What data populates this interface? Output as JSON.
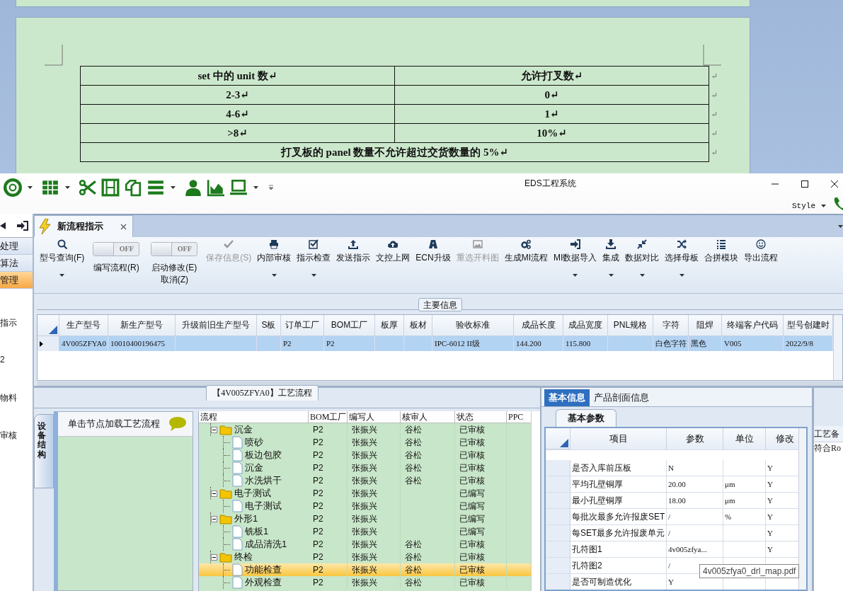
{
  "document": {
    "table": {
      "rows": [
        {
          "cells": [
            "set 中的 unit 数↵",
            "允许打叉数↵"
          ],
          "end_mark": "↵"
        },
        {
          "cells": [
            "2-3↵",
            "0↵"
          ],
          "end_mark": "↵"
        },
        {
          "cells": [
            "4-6↵",
            "1↵"
          ],
          "end_mark": "↵"
        },
        {
          "cells": [
            ">8↵",
            "10%↵"
          ],
          "end_mark": "↵"
        },
        {
          "cells": [
            {
              "text": "打叉板的 panel 数量不允许超过交货数量的 5%↵",
              "colspan": 2
            }
          ],
          "end_mark": "↵"
        }
      ]
    }
  },
  "window": {
    "title": "EDS工程系统",
    "style_menu": "Style"
  },
  "quick_access": [
    {
      "dropdown": true
    },
    {
      "dropdown": true
    },
    {
      "dropdown": false
    },
    {
      "dropdown": false
    },
    {
      "dropdown": false
    },
    {
      "dropdown": true
    },
    {
      "dropdown": false
    },
    {
      "dropdown": false
    },
    {
      "dropdown": true
    },
    {
      "dropdown": true
    }
  ],
  "sidebar": {
    "items": [
      {
        "label": "处理",
        "selected": false
      },
      {
        "label": "算法",
        "selected": false
      },
      {
        "label": "管理",
        "selected": true
      }
    ],
    "texts": [
      "指示",
      "2",
      "物料",
      "审核"
    ]
  },
  "tabs": [
    {
      "label": "新流程指示",
      "selected": true
    }
  ],
  "ribbon": [
    {
      "kind": "button",
      "label": [
        "型号查询(F)"
      ],
      "dropdown": true,
      "disabled": false
    },
    {
      "kind": "toggle",
      "label": [
        "编写流程(R)"
      ],
      "on": false,
      "state_label": "OFF"
    },
    {
      "kind": "toggle",
      "label": [
        "启动修改(E)",
        "取消(Z)"
      ],
      "on": false,
      "state_label": "OFF"
    },
    {
      "kind": "button",
      "label": [
        "保存信息(S)"
      ],
      "dropdown": false,
      "disabled": true
    },
    {
      "kind": "button",
      "label": [
        "内部审核"
      ],
      "dropdown": true,
      "disabled": false
    },
    {
      "kind": "button",
      "label": [
        "指示检查"
      ],
      "dropdown": true,
      "disabled": false
    },
    {
      "kind": "button",
      "label": [
        "发送指示"
      ],
      "dropdown": false,
      "disabled": false
    },
    {
      "kind": "button",
      "label": [
        "文控上网"
      ],
      "dropdown": false,
      "disabled": false
    },
    {
      "kind": "button",
      "label": [
        "ECN升级"
      ],
      "dropdown": false,
      "disabled": false
    },
    {
      "kind": "button",
      "label": [
        "重选开料图"
      ],
      "dropdown": false,
      "disabled": true
    },
    {
      "kind": "button",
      "label": [
        "生成MI流程"
      ],
      "dropdown": false,
      "disabled": false
    },
    {
      "kind": "button",
      "label": [
        "MI数据导入"
      ],
      "dropdown": true,
      "disabled": false
    },
    {
      "kind": "button",
      "label": [
        "集成"
      ],
      "dropdown": true,
      "disabled": false
    },
    {
      "kind": "button",
      "label": [
        "数据对比"
      ],
      "dropdown": true,
      "disabled": false
    },
    {
      "kind": "button",
      "label": [
        "选择母板"
      ],
      "dropdown": true,
      "disabled": false
    },
    {
      "kind": "button",
      "label": [
        "合拼模块"
      ],
      "dropdown": false,
      "disabled": false
    },
    {
      "kind": "button",
      "label": [
        "导出流程"
      ],
      "dropdown": false,
      "disabled": false
    }
  ],
  "main_info": {
    "title": "主要信息",
    "columns": [
      "生产型号",
      "新生产型号",
      "升级前旧生产型号",
      "S板",
      "订单工厂",
      "BOM工厂",
      "板厚",
      "板材",
      "验收标准",
      "成品长度",
      "成品宽度",
      "PNL规格",
      "字符",
      "阻焊",
      "终端客户代码",
      "型号创建时"
    ],
    "rows": [
      {
        "selected": true,
        "cells": [
          "4V005ZFYA0",
          "10010400196475",
          null,
          null,
          "P2",
          "P2",
          null,
          null,
          "IPC-6012 II级",
          "144.200",
          "115.800",
          null,
          "白色字符",
          "黑色",
          "V005",
          "2022/9/8"
        ]
      }
    ]
  },
  "process": {
    "title": "【4V005ZFYA0】工艺流程",
    "side_tab": "设备结构",
    "hint": "单击节点加载工艺流程",
    "columns": [
      "流程",
      "BOM工厂",
      "编写人",
      "核审人",
      "状态",
      "PPC"
    ],
    "tree": [
      {
        "kind": "folder",
        "name": "沉金",
        "expanded": true,
        "selected": false,
        "cells": [
          "P2",
          "张振兴",
          "谷松",
          "已审核"
        ],
        "children": [
          {
            "kind": "file",
            "name": "喷砂",
            "selected": false,
            "cells": [
              "P2",
              "张振兴",
              "谷松",
              "已审核"
            ]
          },
          {
            "kind": "file",
            "name": "板边包胶",
            "selected": false,
            "cells": [
              "P2",
              "张振兴",
              "谷松",
              "已审核"
            ]
          },
          {
            "kind": "file",
            "name": "沉金",
            "selected": false,
            "cells": [
              "P2",
              "张振兴",
              "谷松",
              "已审核"
            ]
          },
          {
            "kind": "file",
            "name": "水洗烘干",
            "selected": false,
            "cells": [
              "P2",
              "张振兴",
              "谷松",
              "已审核"
            ]
          }
        ]
      },
      {
        "kind": "folder",
        "name": "电子测试",
        "expanded": true,
        "selected": false,
        "cells": [
          "P2",
          "张振兴",
          null,
          "已编写"
        ],
        "children": [
          {
            "kind": "file",
            "name": "电子测试",
            "selected": false,
            "cells": [
              "P2",
              "张振兴",
              null,
              "已编写"
            ]
          }
        ]
      },
      {
        "kind": "folder",
        "name": "外形1",
        "expanded": true,
        "selected": false,
        "cells": [
          "P2",
          "张振兴",
          null,
          "已编写"
        ],
        "children": [
          {
            "kind": "file",
            "name": "铣板1",
            "selected": false,
            "cells": [
              "P2",
              "张振兴",
              null,
              "已编写"
            ]
          },
          {
            "kind": "file",
            "name": "成品清洗1",
            "selected": false,
            "cells": [
              "P2",
              "张振兴",
              "谷松",
              "已审核"
            ]
          }
        ]
      },
      {
        "kind": "folder",
        "name": "终检",
        "expanded": true,
        "selected": false,
        "cells": [
          "P2",
          "张振兴",
          "谷松",
          "已审核"
        ],
        "children": [
          {
            "kind": "file",
            "name": "功能检查",
            "selected": true,
            "cells": [
              "P2",
              "张振兴",
              "谷松",
              "已审核"
            ]
          },
          {
            "kind": "file",
            "name": "外观检查",
            "selected": false,
            "cells": [
              "P2",
              "张振兴",
              "谷松",
              "已审核"
            ]
          }
        ]
      }
    ]
  },
  "params": {
    "tabs": [
      {
        "label": "基本信息",
        "selected": true
      },
      {
        "label": "产品剖面信息",
        "selected": false
      }
    ],
    "subtab": "基本参数",
    "columns": [
      "项目",
      "参数",
      "单位",
      "修改"
    ],
    "rows": [
      {
        "cells": [
          "是否入库前压板",
          "N",
          null,
          "Y"
        ]
      },
      {
        "cells": [
          "平均孔壁铜厚",
          "20.00",
          "μm",
          "Y"
        ]
      },
      {
        "cells": [
          "最小孔壁铜厚",
          "18.00",
          "μm",
          "Y"
        ]
      },
      {
        "cells": [
          "每批次最多允许报废SET",
          "/",
          "%",
          "Y"
        ]
      },
      {
        "cells": [
          "每SET最多允许报废单元",
          "/",
          null,
          "Y"
        ]
      },
      {
        "cells": [
          "孔符图1",
          "4v005zfya...",
          null,
          "Y"
        ]
      },
      {
        "cells": [
          "孔符图2",
          "/",
          null,
          null
        ]
      },
      {
        "cells": [
          "是否可制造优化",
          "Y",
          null,
          null
        ]
      }
    ]
  },
  "side_panel": {
    "header": "工艺备",
    "text": "符合Ro"
  },
  "tooltip": "4v005zfya0_drl_map.pdf"
}
